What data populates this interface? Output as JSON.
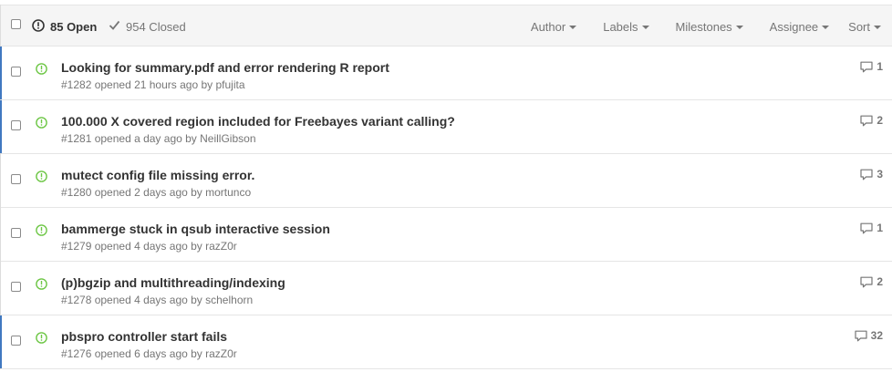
{
  "states": {
    "open_label": "85 Open",
    "closed_label": "954 Closed"
  },
  "filters": [
    "Author",
    "Labels",
    "Milestones",
    "Assignee",
    "Sort"
  ],
  "colors": {
    "open_icon": "#6cc644",
    "unread_bar": "#4078c0"
  },
  "issues": [
    {
      "title": "Looking for summary.pdf and error rendering R report",
      "meta": "#1282 opened 21 hours ago by pfujita",
      "comments": "1",
      "unread": true
    },
    {
      "title": "100.000 X covered region included for Freebayes variant calling?",
      "meta": "#1281 opened a day ago by NeillGibson",
      "comments": "2",
      "unread": true
    },
    {
      "title": "mutect config file missing error.",
      "meta": "#1280 opened 2 days ago by mortunco",
      "comments": "3",
      "unread": false
    },
    {
      "title": "bammerge stuck in qsub interactive session",
      "meta": "#1279 opened 4 days ago by razZ0r",
      "comments": "1",
      "unread": false
    },
    {
      "title": "(p)bgzip and multithreading/indexing",
      "meta": "#1278 opened 4 days ago by schelhorn",
      "comments": "2",
      "unread": false
    },
    {
      "title": "pbspro controller start fails",
      "meta": "#1276 opened 6 days ago by razZ0r",
      "comments": "32",
      "unread": true
    }
  ]
}
